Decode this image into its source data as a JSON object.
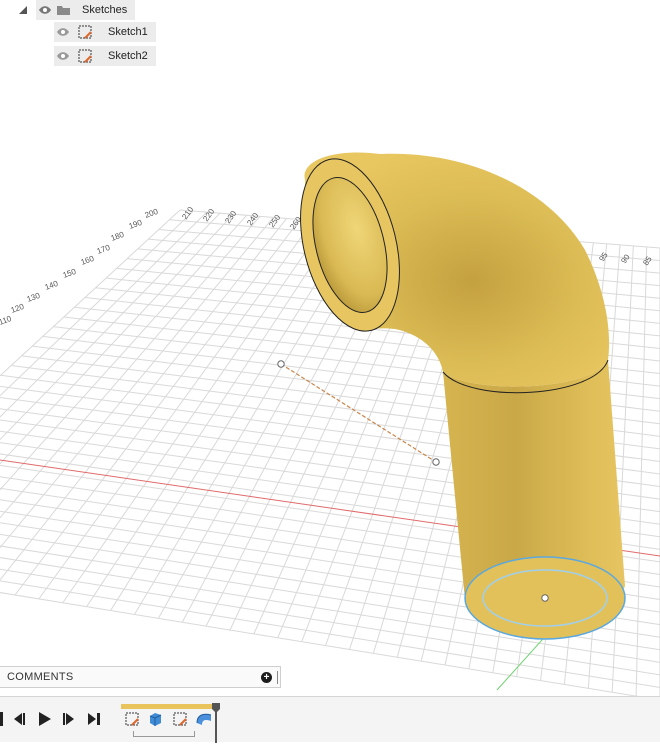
{
  "browser": {
    "folder": {
      "label": "Sketches",
      "visibility_icon": "eye-icon",
      "icon": "folder-icon",
      "expand_icon": "triangle-collapse-icon"
    },
    "items": [
      {
        "label": "Sketch1",
        "visibility_icon": "eye-icon",
        "icon": "sketch-icon"
      },
      {
        "label": "Sketch2",
        "visibility_icon": "eye-icon",
        "icon": "sketch-icon"
      }
    ]
  },
  "viewport": {
    "body_color": "#e8c35a",
    "grid_left_labels": [
      "200",
      "190",
      "180",
      "170",
      "160",
      "150",
      "140",
      "130",
      "120",
      "110"
    ],
    "grid_top_labels": [
      "210",
      "220",
      "230",
      "240",
      "250",
      "260"
    ],
    "grid_right_labels": [
      "95",
      "90",
      "85"
    ]
  },
  "comments": {
    "title": "COMMENTS",
    "add_icon": "plus-circle-icon"
  },
  "timeline": {
    "controls": [
      "skip-to-start-icon",
      "step-back-icon",
      "play-icon",
      "step-forward-icon",
      "skip-to-end-icon"
    ],
    "features": [
      "sketch-icon",
      "extrude-icon",
      "sketch-icon",
      "sweep-icon"
    ],
    "marker_icon": "timeline-marker-icon"
  }
}
